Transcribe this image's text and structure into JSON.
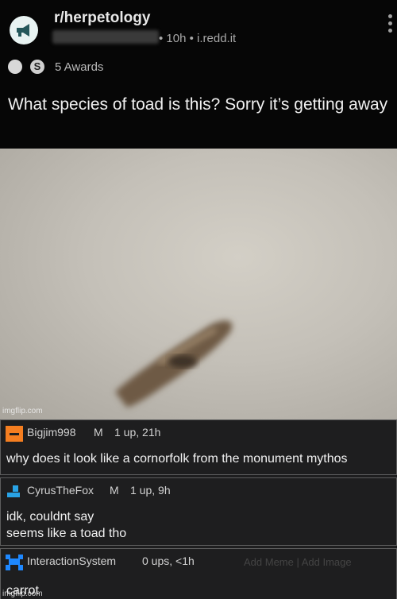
{
  "post": {
    "subreddit": "r/herpetology",
    "meta": "• 10h • i.redd.it",
    "awards_label": "5 Awards",
    "award_2_glyph": "S",
    "title": "What species of toad is this? Sorry it’s getting away"
  },
  "image": {
    "watermark": "imgflip.com"
  },
  "comments": [
    {
      "user": "Bigjim998",
      "badge": "M",
      "meta": "1 up, 21h",
      "body": "why does it look like a cornorfolk from the monument mythos",
      "avatar_color": "#f57e20"
    },
    {
      "user": "CyrusTheFox",
      "badge": "M",
      "meta": "1 up, 9h",
      "body_line1": "idk, couldnt say",
      "body_line2": "seems like a toad tho",
      "avatar_color": "#29a3e6"
    },
    {
      "user": "InteractionSystem",
      "badge": "",
      "meta": "0 ups, <1h",
      "body": "carrot",
      "avatar_color": "#1e88ff",
      "faint_actions": "Add Meme | Add Image"
    }
  ],
  "footer": {
    "watermark": "imgflip.com"
  },
  "colors": {
    "post_bg": "#060606",
    "comment_bg": "#1e1e1f",
    "border": "#5d5d5d"
  }
}
